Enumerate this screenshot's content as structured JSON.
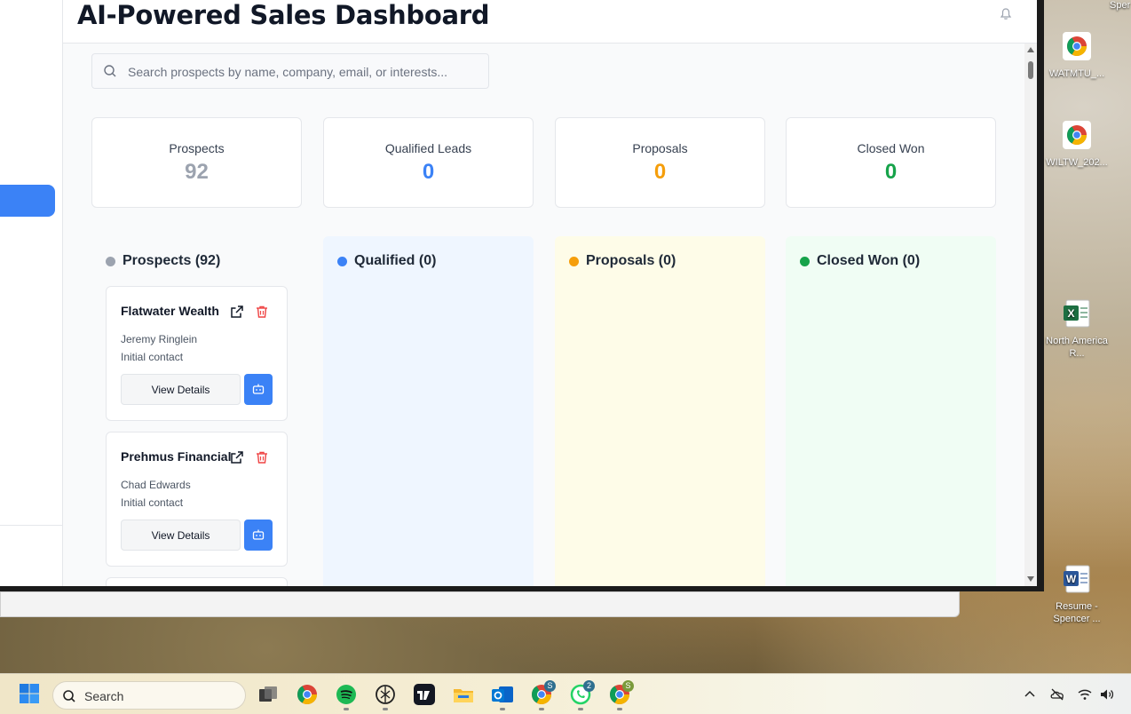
{
  "app": {
    "title": "AI-Powered Sales Dashboard",
    "search_placeholder": "Search prospects by name, company, email, or interests..."
  },
  "stats": [
    {
      "label": "Prospects",
      "value": "92",
      "color": "#9ca3af"
    },
    {
      "label": "Qualified Leads",
      "value": "0",
      "color": "#3b82f6"
    },
    {
      "label": "Proposals",
      "value": "0",
      "color": "#f59e0b"
    },
    {
      "label": "Closed Won",
      "value": "0",
      "color": "#16a34a"
    }
  ],
  "columns": [
    {
      "label": "Prospects (92)",
      "dot_color": "#9ca3af",
      "bg": "#f9fafb"
    },
    {
      "label": "Qualified (0)",
      "dot_color": "#3b82f6",
      "bg": "#eff6ff"
    },
    {
      "label": "Proposals (0)",
      "dot_color": "#f59e0b",
      "bg": "#fefce8"
    },
    {
      "label": "Closed Won (0)",
      "dot_color": "#16a34a",
      "bg": "#f0fdf4"
    }
  ],
  "cards": [
    {
      "company": "Flatwater Wealth",
      "contact": "Jeremy Ringlein",
      "stage": "Initial contact",
      "details_label": "View Details"
    },
    {
      "company": "Prehmus Financial",
      "contact": "Chad Edwards",
      "stage": "Initial contact",
      "details_label": "View Details"
    }
  ],
  "desktop": {
    "top_label": "Sper",
    "icons": [
      {
        "label": "WATMTU_...",
        "icon": "chrome-icon"
      },
      {
        "label": "WILTW_202...",
        "icon": "chrome-icon"
      },
      {
        "label": "North America R...",
        "icon": "excel-icon"
      },
      {
        "label": "Resume - Spencer ...",
        "icon": "word-icon"
      }
    ]
  },
  "taskbar": {
    "search_label": "Search",
    "badges": {
      "chrome_profile_1": "S",
      "whatsapp": "2",
      "chrome_profile_2": "S"
    }
  }
}
